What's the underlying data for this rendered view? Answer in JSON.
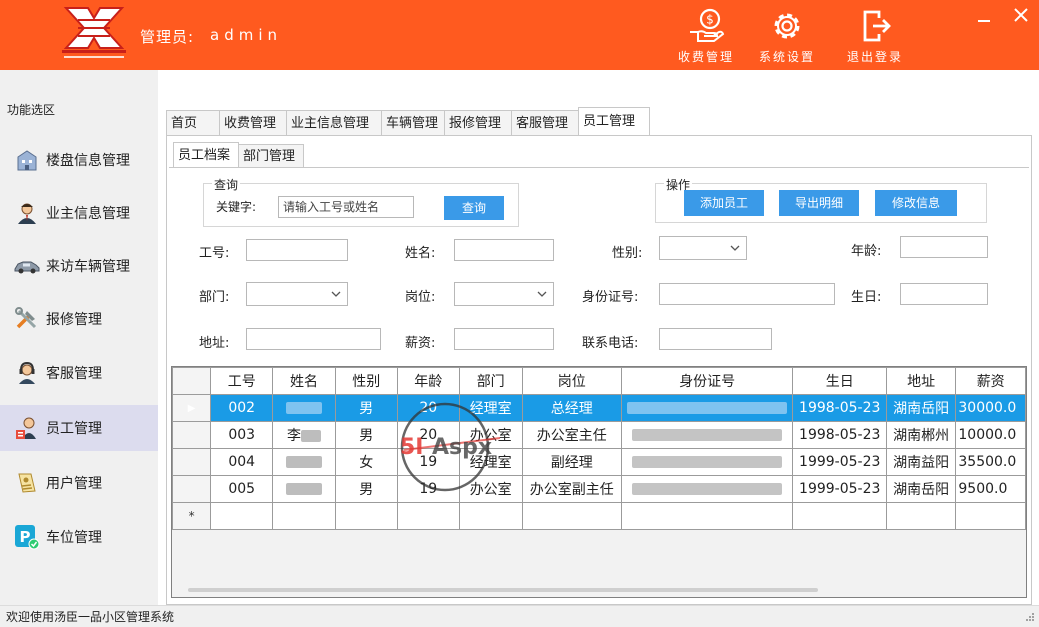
{
  "header": {
    "admin_label": "管理员:",
    "admin_name": "admin",
    "buttons": [
      {
        "label": "收费管理",
        "icon": "hand-coin-icon"
      },
      {
        "label": "系统设置",
        "icon": "gear-icon"
      },
      {
        "label": "退出登录",
        "icon": "logout-icon"
      }
    ],
    "colors": {
      "bar": "#ff5a1f",
      "accent": "#3a9ae8",
      "selected_row": "#1a9be6"
    }
  },
  "sidebar": {
    "title": "功能选区",
    "items": [
      {
        "label": "楼盘信息管理",
        "icon": "building-icon"
      },
      {
        "label": "业主信息管理",
        "icon": "person-icon"
      },
      {
        "label": "来访车辆管理",
        "icon": "car-icon"
      },
      {
        "label": "报修管理",
        "icon": "tools-icon"
      },
      {
        "label": "客服管理",
        "icon": "headset-icon"
      },
      {
        "label": "员工管理",
        "icon": "staff-icon"
      },
      {
        "label": "用户管理",
        "icon": "user-card-icon"
      },
      {
        "label": "车位管理",
        "icon": "parking-icon"
      }
    ],
    "active_index": 5
  },
  "tabs": [
    "首页",
    "收费管理",
    "业主信息管理",
    "车辆管理",
    "报修管理",
    "客服管理",
    "员工管理"
  ],
  "subtabs": [
    "员工档案",
    "部门管理"
  ],
  "query": {
    "group_title": "查询",
    "keyword_label": "关键字:",
    "keyword_placeholder": "请输入工号或姓名",
    "search_label": "查询"
  },
  "actions": {
    "group_title": "操作",
    "buttons": [
      "添加员工",
      "导出明细",
      "修改信息"
    ]
  },
  "form": {
    "emp_no": "工号:",
    "name": "姓名:",
    "gender": "性别:",
    "age": "年龄:",
    "dept": "部门:",
    "position": "岗位:",
    "id_card": "身份证号:",
    "birthday": "生日:",
    "address": "地址:",
    "salary": "薪资:",
    "phone": "联系电话:"
  },
  "grid": {
    "columns": [
      "工号",
      "姓名",
      "性别",
      "年龄",
      "部门",
      "岗位",
      "身份证号",
      "生日",
      "地址",
      "薪资"
    ],
    "rows": [
      {
        "emp_no": "002",
        "name": "",
        "gender": "男",
        "age": "20",
        "dept": "经理室",
        "position": "总经理",
        "id_card": "",
        "birthday": "1998-05-23",
        "address": "湖南岳阳",
        "salary": "30000.0"
      },
      {
        "emp_no": "003",
        "name": "李",
        "gender": "男",
        "age": "20",
        "dept": "办公室",
        "position": "办公室主任",
        "id_card": "",
        "birthday": "1998-05-23",
        "address": "湖南郴州",
        "salary": "10000.0"
      },
      {
        "emp_no": "004",
        "name": "",
        "gender": "女",
        "age": "19",
        "dept": "经理室",
        "position": "副经理",
        "id_card": "",
        "birthday": "1999-05-23",
        "address": "湖南益阳",
        "salary": "35500.0"
      },
      {
        "emp_no": "005",
        "name": "",
        "gender": "男",
        "age": "19",
        "dept": "办公室",
        "position": "办公室副主任",
        "id_card": "",
        "birthday": "1999-05-23",
        "address": "湖南岳阳",
        "salary": "9500.0"
      }
    ],
    "new_row_marker": "*"
  },
  "status": "欢迎使用汤臣一品小区管理系统"
}
